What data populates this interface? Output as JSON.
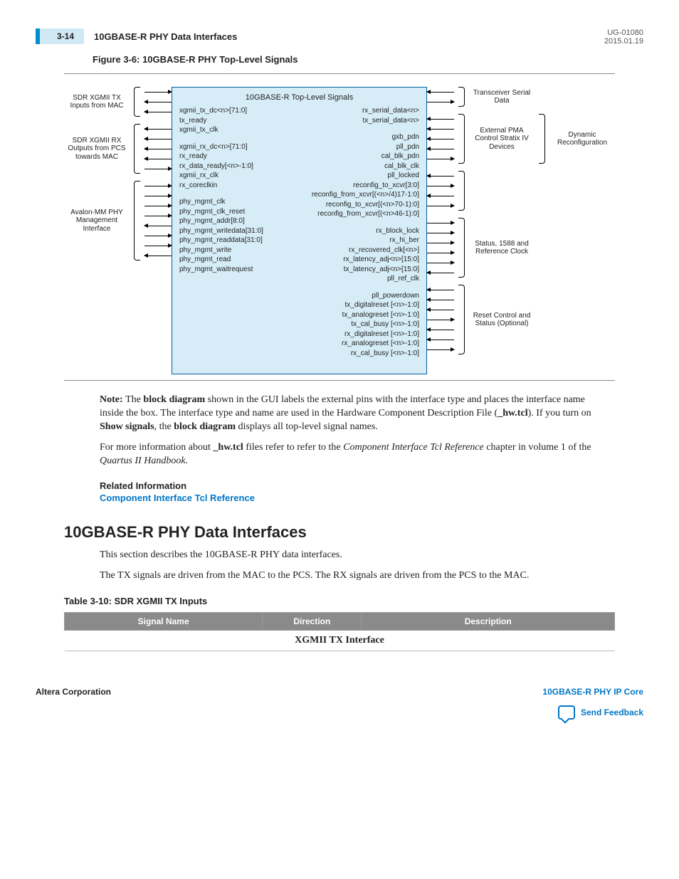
{
  "header": {
    "page_num": "3-14",
    "title": "10GBASE-R PHY Data Interfaces",
    "doc_id": "UG-01080",
    "date": "2015.01.19"
  },
  "figure_caption": "Figure 3-6: 10GBASE-R PHY Top-Level Signals",
  "diagram": {
    "title": "10GBASE-R Top-Level Signals",
    "left_groups": [
      {
        "label": "SDR XGMII TX Inputs from MAC",
        "signals": [
          "xgmii_tx_dc<n>[71:0]",
          "tx_ready",
          "xgmii_tx_clk"
        ],
        "dirs": [
          "right",
          "left",
          "left"
        ]
      },
      {
        "label": "SDR XGMII RX Outputs from PCS towards MAC",
        "signals": [
          "xgmii_rx_dc<n>[71:0]",
          "rx_ready",
          "rx_data_ready[<n>-1:0]",
          "xgmii_rx_clk",
          "rx_coreclkin"
        ],
        "dirs": [
          "left",
          "left",
          "left",
          "left",
          "right"
        ]
      },
      {
        "label": "Avalon-MM PHY Management Interface",
        "signals": [
          "phy_mgmt_clk",
          "phy_mgmt_clk_reset",
          "phy_mgmt_addr[8:0]",
          "phy_mgmt_writedata[31:0]",
          "phy_mgmt_readdata[31:0]",
          "phy_mgmt_write",
          "phy_mgmt_read",
          "phy_mgmt_waitrequest"
        ],
        "dirs": [
          "right",
          "right",
          "right",
          "right",
          "left",
          "right",
          "right",
          "left"
        ]
      }
    ],
    "right_signal_blocks": [
      [
        "rx_serial_data<n>",
        "tx_serial_data<n>"
      ],
      [
        "gxb_pdn",
        "pll_pdn",
        "cal_blk_pdn",
        "cal_blk_clk",
        "pll_locked",
        "reconfig_to_xcvr[3:0]",
        "reconfig_from_xcvr[(<n>/4)17-1:0]",
        "reconfig_to_xcvr[(<n>70-1):0]",
        "reconfig_from_xcvr[(<n>46-1):0]"
      ],
      [
        "rx_block_lock",
        "rx_hi_ber",
        "rx_recovered_clk[<n>]",
        "rx_latency_adj<n>[15:0]",
        "tx_latency_adj<n>[15:0]",
        "pll_ref_clk"
      ],
      [
        "pll_powerdown",
        "tx_digitalreset [<n>-1:0]",
        "tx_analogreset [<n>-1:0]",
        "tx_cal_busy [<n>-1:0]",
        "rx_digitalreset [<n>-1:0]",
        "rx_analogreset [<n>-1:0]",
        "rx_cal_busy [<n>-1:0]"
      ]
    ],
    "right_groups": [
      {
        "label": "Transceiver Serial Data",
        "count": 2,
        "dirs": [
          "left",
          "right"
        ]
      },
      {
        "label": "External PMA Control Stratix IV Devices",
        "count": 5,
        "dirs": [
          "left",
          "left",
          "left",
          "left",
          "right"
        ],
        "outer": "Dynamic Reconfiguration"
      },
      {
        "label_hidden": true,
        "count": 4,
        "dirs": [
          "left",
          "right",
          "left",
          "right"
        ]
      },
      {
        "label": "Status, 1588 and Reference Clock",
        "count": 6,
        "dirs": [
          "right",
          "right",
          "right",
          "right",
          "right",
          "left"
        ]
      },
      {
        "label": "Reset Control and Status (Optional)",
        "count": 7,
        "dirs": [
          "left",
          "left",
          "left",
          "right",
          "left",
          "left",
          "right"
        ]
      }
    ]
  },
  "note": {
    "label": "Note:",
    "text_parts": [
      "The ",
      "block diagram",
      " shown in the GUI labels the external pins with the interface type and places the interface name inside the box. The interface type and name are used in the Hardware Component Description File (",
      "_hw.tcl",
      "). If you turn on ",
      "Show signals",
      ", the ",
      "block diagram",
      " displays all top-level signal names."
    ]
  },
  "para2_parts": [
    "For more information about ",
    "_hw.tcl",
    " files refer to refer to the ",
    "Component Interface Tcl Reference",
    " chapter in volume 1 of the ",
    "Quartus II Handbook",
    "."
  ],
  "related_info": {
    "heading": "Related Information",
    "link": "Component Interface Tcl Reference"
  },
  "section": {
    "heading": "10GBASE-R PHY Data Interfaces",
    "p1": "This section describes the 10GBASE-R PHY data interfaces.",
    "p2": "The TX signals are driven from the MAC to the PCS. The RX signals are driven from the PCS to the MAC."
  },
  "table": {
    "caption": "Table 3-10: SDR XGMII TX Inputs",
    "headers": [
      "Signal Name",
      "Direction",
      "Description"
    ],
    "section_row": "XGMII TX Interface"
  },
  "footer": {
    "left": "Altera Corporation",
    "right_link": "10GBASE-R PHY IP Core",
    "feedback": "Send Feedback"
  }
}
